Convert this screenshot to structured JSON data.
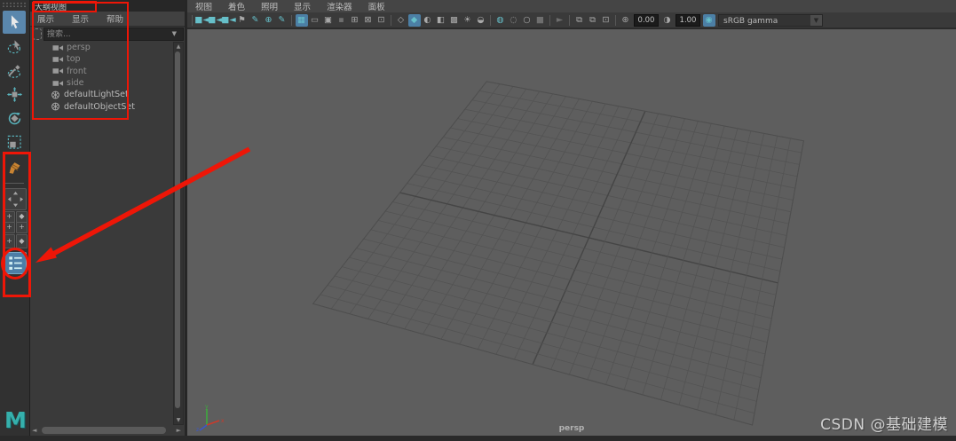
{
  "toolbox": {
    "tools": [
      {
        "name": "select-tool",
        "active": true
      },
      {
        "name": "lasso-select-tool",
        "active": false
      },
      {
        "name": "paint-select-tool",
        "active": false
      },
      {
        "name": "move-tool",
        "active": false
      },
      {
        "name": "rotate-tool",
        "active": false
      },
      {
        "name": "scale-tool",
        "active": false
      }
    ],
    "last_tool": {
      "name": "last-tool-used"
    },
    "layout_buttons": [
      {
        "name": "single-pane-layout-button",
        "kind": "single"
      },
      {
        "name": "four-pane-layout-buttons",
        "kind": "pair",
        "glyphs": [
          "+",
          "◆"
        ]
      },
      {
        "name": "three-pane-layout-buttons",
        "kind": "pair",
        "glyphs": [
          "+",
          "+"
        ]
      },
      {
        "name": "two-pane-layout-buttons",
        "kind": "pairtall",
        "glyphs": [
          "+",
          "◆"
        ]
      },
      {
        "name": "outliner-persp-layout-button",
        "kind": "outliner",
        "active": true
      }
    ],
    "logo_letter": "M"
  },
  "outliner": {
    "tab_title": "大纲视图",
    "menus": [
      {
        "label": "展示"
      },
      {
        "label": "显示"
      },
      {
        "label": "帮助"
      }
    ],
    "search_placeholder": "搜索...",
    "items": [
      {
        "label": "persp",
        "icon": "camera-icon",
        "dim": true
      },
      {
        "label": "top",
        "icon": "camera-icon",
        "dim": true
      },
      {
        "label": "front",
        "icon": "camera-icon",
        "dim": true
      },
      {
        "label": "side",
        "icon": "camera-icon",
        "dim": true
      },
      {
        "label": "defaultLightSet",
        "icon": "set-icon",
        "dim": false
      },
      {
        "label": "defaultObjectSet",
        "icon": "set-icon",
        "dim": false
      }
    ]
  },
  "viewport": {
    "menus": [
      {
        "label": "视图"
      },
      {
        "label": "着色"
      },
      {
        "label": "照明"
      },
      {
        "label": "显示"
      },
      {
        "label": "渲染器"
      },
      {
        "label": "面板"
      }
    ],
    "toolbar_items": [
      {
        "type": "sep"
      },
      {
        "type": "icon",
        "name": "camera-select-icon",
        "glyph": "■◄",
        "color": "teal"
      },
      {
        "type": "icon",
        "name": "camera-lock-icon",
        "glyph": "■◄",
        "color": "teal"
      },
      {
        "type": "icon",
        "name": "camera-attributes-icon",
        "glyph": "■◄",
        "color": "teal"
      },
      {
        "type": "icon",
        "name": "bookmark-icon",
        "glyph": "⚑",
        "color": "gray"
      },
      {
        "type": "icon",
        "name": "grease-pencil-icon",
        "glyph": "✎",
        "color": "teal"
      },
      {
        "type": "icon",
        "name": "snap-icon",
        "glyph": "⊕",
        "color": "teal"
      },
      {
        "type": "icon",
        "name": "annotate-pen-icon",
        "glyph": "✎",
        "color": "teal"
      },
      {
        "type": "sep"
      },
      {
        "type": "icon",
        "name": "grid-toggle-icon",
        "glyph": "▦",
        "color": "teal",
        "active": true
      },
      {
        "type": "icon",
        "name": "film-gate-icon",
        "glyph": "▭",
        "color": "gray"
      },
      {
        "type": "icon",
        "name": "resolution-gate-icon",
        "glyph": "▣",
        "color": "gray"
      },
      {
        "type": "icon",
        "name": "gate-mask-icon",
        "glyph": "▪",
        "color": "dim"
      },
      {
        "type": "icon",
        "name": "field-chart-icon",
        "glyph": "⊞",
        "color": "gray"
      },
      {
        "type": "icon",
        "name": "safe-action-icon",
        "glyph": "⊠",
        "color": "gray"
      },
      {
        "type": "icon",
        "name": "safe-title-icon",
        "glyph": "⊡",
        "color": "gray"
      },
      {
        "type": "sep"
      },
      {
        "type": "icon",
        "name": "wireframe-icon",
        "glyph": "◇",
        "color": "gray"
      },
      {
        "type": "icon",
        "name": "smooth-shade-icon",
        "glyph": "◆",
        "color": "teal",
        "active": true
      },
      {
        "type": "icon",
        "name": "flat-shade-icon",
        "glyph": "◐",
        "color": "gray"
      },
      {
        "type": "icon",
        "name": "textured-icon",
        "glyph": "◧",
        "color": "gray"
      },
      {
        "type": "icon",
        "name": "use-default-material-icon",
        "glyph": "▩",
        "color": "gray"
      },
      {
        "type": "icon",
        "name": "lights-icon",
        "glyph": "☀",
        "color": "gray"
      },
      {
        "type": "icon",
        "name": "shadows-icon",
        "glyph": "◒",
        "color": "gray"
      },
      {
        "type": "sep"
      },
      {
        "type": "icon",
        "name": "ambient-occlusion-icon",
        "glyph": "◍",
        "color": "teal"
      },
      {
        "type": "icon",
        "name": "motion-blur-icon",
        "glyph": "◌",
        "color": "gray"
      },
      {
        "type": "icon",
        "name": "antialias-icon",
        "glyph": "○",
        "color": "gray"
      },
      {
        "type": "icon",
        "name": "transparency-icon",
        "glyph": "■",
        "color": "dim"
      },
      {
        "type": "sep"
      },
      {
        "type": "icon",
        "name": "isolate-select-icon",
        "glyph": "►",
        "color": "dim"
      },
      {
        "type": "sep"
      },
      {
        "type": "icon",
        "name": "snapshot-icon",
        "glyph": "⧉",
        "color": "gray"
      },
      {
        "type": "icon",
        "name": "multi-snapshot-icon",
        "glyph": "⧉",
        "color": "gray"
      },
      {
        "type": "icon",
        "name": "image-plane-icon",
        "glyph": "⊡",
        "color": "gray"
      },
      {
        "type": "sep"
      },
      {
        "type": "icon",
        "name": "exposure-icon",
        "glyph": "⊛",
        "color": "gray"
      },
      {
        "type": "field",
        "name": "exposure-field",
        "value": "0.00"
      },
      {
        "type": "icon",
        "name": "gamma-icon",
        "glyph": "◑",
        "color": "gray"
      },
      {
        "type": "field",
        "name": "gamma-field",
        "value": "1.00"
      },
      {
        "type": "icon",
        "name": "color-management-icon",
        "glyph": "◉",
        "color": "teal",
        "active": true
      },
      {
        "type": "select",
        "name": "view-transform-select",
        "value": "sRGB gamma"
      }
    ],
    "grid_divisions": 24,
    "camera_label": "persp"
  },
  "watermark": "CSDN @基础建模",
  "annotation_color": "#ee1607"
}
